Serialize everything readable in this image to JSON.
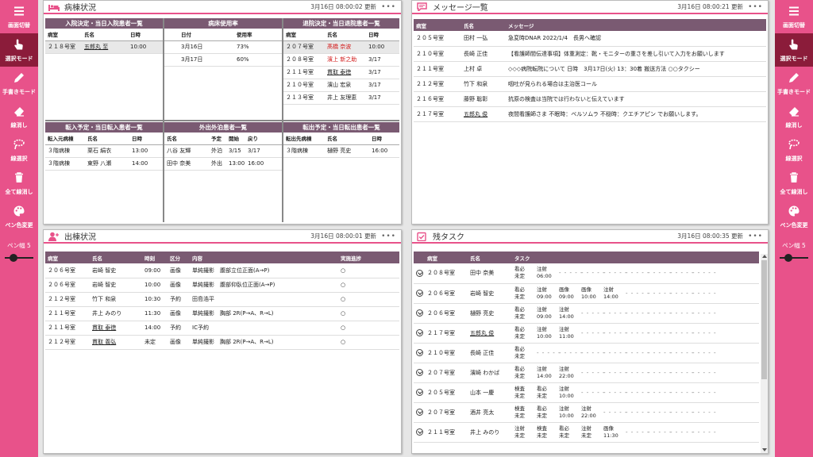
{
  "colors": {
    "accent": "#e8528a",
    "header": "#7a5a72",
    "active": "#8b1c3a",
    "red": "#d21c1c"
  },
  "sidebar": {
    "buttons": [
      {
        "label": "画面切替",
        "icon": "menu-icon",
        "active": false
      },
      {
        "label": "選択モード",
        "icon": "pointer-hand-icon",
        "active": true
      },
      {
        "label": "手書きモード",
        "icon": "pencil-icon",
        "active": false
      },
      {
        "label": "線消し",
        "icon": "eraser-icon",
        "active": false
      },
      {
        "label": "線選択",
        "icon": "lasso-select-icon",
        "active": false
      },
      {
        "label": "全て線消し",
        "icon": "trash-icon",
        "active": false
      },
      {
        "label": "ペン色変更",
        "icon": "palette-icon",
        "active": false
      }
    ],
    "pen_width_label": "ペン幅 5"
  },
  "ward": {
    "title": "病棟状況",
    "timestamp": "3月16日 08:00:02 更新",
    "dots": "•••",
    "admissions": {
      "title": "入院決定・当日入院患者一覧",
      "headers": [
        "病室",
        "氏名",
        "日時"
      ],
      "rows": [
        [
          "２１８号室",
          "五郎丸 至",
          "10:00"
        ]
      ]
    },
    "occupancy": {
      "title": "病床使用率",
      "headers": [
        "日付",
        "使用率"
      ],
      "rows": [
        [
          "3月16日",
          "73%"
        ],
        [
          "3月17日",
          "60%"
        ]
      ]
    },
    "discharges": {
      "title": "退院決定・当日退院患者一覧",
      "headers": [
        "病室",
        "氏名",
        "日時"
      ],
      "rows": [
        [
          "２０７号室",
          "髙橋 奈波",
          "10:00"
        ],
        [
          "２０８号室",
          "濱上 新之助",
          "3/17"
        ],
        [
          "２１１号室",
          "貫取 泰徳",
          "3/17"
        ],
        [
          "２１０号室",
          "濱山 宏泉",
          "3/17"
        ],
        [
          "２１３号室",
          "井上 友理恵",
          "3/17"
        ]
      ]
    },
    "transfers_in": {
      "title": "転入予定・当日転入患者一覧",
      "headers": [
        "転入元病棟",
        "氏名",
        "日時"
      ],
      "rows": [
        [
          "３階病棟",
          "栗石 絹衣",
          "13:00"
        ],
        [
          "３階病棟",
          "東野 八瀬",
          "14:00"
        ]
      ]
    },
    "outings": {
      "title": "外出外泊患者一覧",
      "headers": [
        "氏名",
        "予定",
        "開始",
        "戻り"
      ],
      "rows": [
        [
          "八谷 友輝",
          "外泊",
          "3/15",
          "3/17"
        ],
        [
          "田中 奈美",
          "外出",
          "13:00",
          "16:00"
        ]
      ]
    },
    "transfers_out": {
      "title": "転出予定・当日転出患者一覧",
      "headers": [
        "転出先病棟",
        "氏名",
        "日時"
      ],
      "rows": [
        [
          "３階病棟",
          "樋野 亮史",
          "16:00"
        ]
      ]
    }
  },
  "messages": {
    "title": "メッセージ一覧",
    "timestamp": "3月16日 08:00:21 更新",
    "dots": "•••",
    "headers": [
      "病室",
      "氏名",
      "メッセージ"
    ],
    "rows": [
      [
        "２０５号室",
        "田村 一弘",
        "急変時DNAR 2022/1/4　長男へ確認"
      ],
      [
        "２１０号室",
        "長崎 正佳",
        "【看護師間伝達事項】体重測定：靴・モニターの重さを差し引いて入力をお願いします"
      ],
      [
        "２１１号室",
        "上村 卓",
        "◇◇◇病院転院について 日時　3月17日(火) 13：30着 搬送方法 ○○タクシー"
      ],
      [
        "２１２号室",
        "竹下 和泉",
        "咽吐が見られる場合は主治医コール"
      ],
      [
        "２１６号室",
        "藤野 聡彰",
        "抗原の検査は当院では行わないと伝えています"
      ],
      [
        "２１７号室",
        "五郎丸 俊",
        "夜間看護師さま 不眠時：ベルソムラ 不穏時：クエチアピン でお願いします。"
      ]
    ]
  },
  "exits": {
    "title": "出棟状況",
    "timestamp": "3月16日 08:00:01 更新",
    "dots": "•••",
    "headers": [
      "病室",
      "氏名",
      "時刻",
      "区分",
      "内容",
      "実施進捗"
    ],
    "rows": [
      [
        "２０６号室",
        "岩崎 智史",
        "09:00",
        "画像",
        "単純撮影　腹部立位正面(A→P)",
        "○"
      ],
      [
        "２０６号室",
        "岩崎 智史",
        "10:00",
        "画像",
        "単純撮影　腹部仰臥位正面(A→P)",
        "○"
      ],
      [
        "２１２号室",
        "竹下 和泉",
        "10:30",
        "予約",
        "田島浩平",
        "○"
      ],
      [
        "２１１号室",
        "井上 みのり",
        "11:30",
        "画像",
        "単純撮影　胸部 2R(P→A、R→L)",
        "○"
      ],
      [
        "２１１号室",
        "貫取 泰徳",
        "14:00",
        "予約",
        "IC予約",
        "○"
      ],
      [
        "２１２号室",
        "貫取 義弘",
        "未定",
        "画像",
        "単純撮影　胸部 2R(P→A、R→L)",
        "○"
      ]
    ]
  },
  "tasks": {
    "title": "残タスク",
    "timestamp": "3月16日 08:00:35 更新",
    "dots": "•••",
    "headers": [
      "病室",
      "氏名",
      "タスク"
    ],
    "empty_mark": "- - - - -",
    "rows": [
      {
        "room": "２０８号室",
        "name": "田中 奈美",
        "tasks": [
          [
            "看必",
            "未定"
          ],
          [
            "注射",
            "06:00"
          ]
        ]
      },
      {
        "room": "２０６号室",
        "name": "岩崎 智史",
        "tasks": [
          [
            "看必",
            "未定"
          ],
          [
            "注射",
            "09:00"
          ],
          [
            "画像",
            "09:00"
          ],
          [
            "画像",
            "10:00"
          ],
          [
            "注射",
            "14:00"
          ]
        ]
      },
      {
        "room": "２０６号室",
        "name": "樋野 亮史",
        "tasks": [
          [
            "看必",
            "未定"
          ],
          [
            "注射",
            "09:00"
          ],
          [
            "注射",
            "14:00"
          ]
        ]
      },
      {
        "room": "２１７号室",
        "name": "五郎丸 俊",
        "tasks": [
          [
            "看必",
            "未定"
          ],
          [
            "注射",
            "10:00"
          ],
          [
            "注射",
            "11:00"
          ]
        ]
      },
      {
        "room": "２１０号室",
        "name": "長崎 正佳",
        "tasks": [
          [
            "看必",
            "未定"
          ]
        ]
      },
      {
        "room": "２０７号室",
        "name": "濱崎 わかば",
        "tasks": [
          [
            "看必",
            "未定"
          ],
          [
            "注射",
            "14:00"
          ],
          [
            "注射",
            "22:00"
          ]
        ]
      },
      {
        "room": "２０５号室",
        "name": "山本 一慶",
        "tasks": [
          [
            "検査",
            "未定"
          ],
          [
            "看必",
            "未定"
          ],
          [
            "注射",
            "10:00"
          ]
        ]
      },
      {
        "room": "２０７号室",
        "name": "酒井 亮太",
        "tasks": [
          [
            "検査",
            "未定"
          ],
          [
            "看必",
            "未定"
          ],
          [
            "注射",
            "10:00"
          ],
          [
            "注射",
            "22:00"
          ]
        ]
      },
      {
        "room": "２１１号室",
        "name": "井上 みのり",
        "tasks": [
          [
            "注射",
            "未定"
          ],
          [
            "検査",
            "未定"
          ],
          [
            "看必",
            "未定"
          ],
          [
            "注射",
            "未定"
          ],
          [
            "画像",
            "11:30"
          ]
        ]
      }
    ]
  }
}
